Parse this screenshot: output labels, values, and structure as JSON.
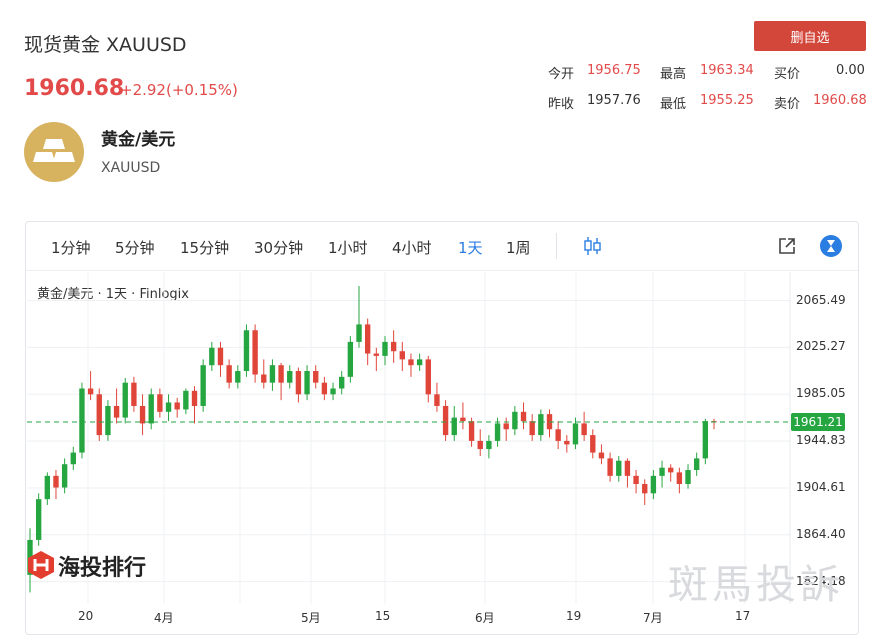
{
  "header": {
    "title": "现货黄金 XAUUSD",
    "price": "1960.68",
    "change": "+2.92(+0.15%)",
    "remove_button": "删自选"
  },
  "stats": [
    {
      "label": "今开",
      "value": "1956.75"
    },
    {
      "label": "最高",
      "value": "1963.34"
    },
    {
      "label": "买价",
      "value": "0.00"
    },
    {
      "label": "昨收",
      "value": "1957.76"
    },
    {
      "label": "最低",
      "value": "1955.25"
    },
    {
      "label": "卖价",
      "value": "1960.68"
    }
  ],
  "instrument": {
    "name": "黄金/美元",
    "code": "XAUUSD"
  },
  "toolbar": {
    "timeframes": [
      "1分钟",
      "5分钟",
      "15分钟",
      "30分钟",
      "1小时",
      "4小时",
      "1天",
      "1周"
    ],
    "active": "1天"
  },
  "chart_data": {
    "type": "candlestick",
    "legend": "黄金/美元 · 1天 · Finlogix",
    "y_ticks": [
      2065.49,
      2025.27,
      1985.05,
      1944.83,
      1904.61,
      1864.4,
      1824.18
    ],
    "ylim": [
      1805,
      2090
    ],
    "x_ticks": [
      "20",
      "4月",
      "5月",
      "15",
      "6月",
      "19",
      "7月",
      "17"
    ],
    "current_price": "1961.21",
    "candles": [
      [
        1830,
        1860,
        1815,
        1870
      ],
      [
        1860,
        1895,
        1855,
        1900
      ],
      [
        1895,
        1915,
        1890,
        1918
      ],
      [
        1915,
        1905,
        1895,
        1920
      ],
      [
        1905,
        1925,
        1900,
        1930
      ],
      [
        1925,
        1935,
        1920,
        1940
      ],
      [
        1935,
        1990,
        1930,
        1995
      ],
      [
        1990,
        1985,
        1980,
        2005
      ],
      [
        1985,
        1950,
        1945,
        1990
      ],
      [
        1950,
        1975,
        1945,
        1980
      ],
      [
        1975,
        1965,
        1960,
        1990
      ],
      [
        1965,
        1995,
        1960,
        1999
      ],
      [
        1995,
        1975,
        1970,
        2000
      ],
      [
        1975,
        1960,
        1950,
        1985
      ],
      [
        1960,
        1985,
        1955,
        1990
      ],
      [
        1985,
        1970,
        1965,
        1990
      ],
      [
        1970,
        1978,
        1962,
        1985
      ],
      [
        1978,
        1972,
        1965,
        1982
      ],
      [
        1972,
        1988,
        1968,
        1990
      ],
      [
        1988,
        1975,
        1960,
        1992
      ],
      [
        1975,
        2010,
        1970,
        2015
      ],
      [
        2010,
        2025,
        2005,
        2030
      ],
      [
        2025,
        2010,
        2000,
        2030
      ],
      [
        2010,
        1995,
        1990,
        2015
      ],
      [
        1995,
        2005,
        1990,
        2010
      ],
      [
        2005,
        2040,
        2000,
        2045
      ],
      [
        2040,
        2002,
        1995,
        2045
      ],
      [
        2002,
        1995,
        1990,
        2015
      ],
      [
        1995,
        2010,
        1988,
        2015
      ],
      [
        2010,
        1995,
        1980,
        2012
      ],
      [
        1995,
        2005,
        1990,
        2010
      ],
      [
        2005,
        1985,
        1978,
        2008
      ],
      [
        1985,
        2005,
        1980,
        2010
      ],
      [
        2005,
        1995,
        1990,
        2010
      ],
      [
        1995,
        1985,
        1980,
        2000
      ],
      [
        1985,
        1990,
        1980,
        1995
      ],
      [
        1990,
        2000,
        1985,
        2005
      ],
      [
        2000,
        2030,
        1995,
        2035
      ],
      [
        2030,
        2045,
        2025,
        2078
      ],
      [
        2045,
        2020,
        2010,
        2050
      ],
      [
        2020,
        2018,
        2005,
        2025
      ],
      [
        2018,
        2030,
        2010,
        2035
      ],
      [
        2030,
        2022,
        2012,
        2040
      ],
      [
        2022,
        2015,
        2005,
        2030
      ],
      [
        2015,
        2010,
        2000,
        2020
      ],
      [
        2010,
        2015,
        2005,
        2020
      ],
      [
        2015,
        1985,
        1978,
        2018
      ],
      [
        1985,
        1975,
        1970,
        1995
      ],
      [
        1975,
        1950,
        1945,
        1980
      ],
      [
        1950,
        1965,
        1945,
        1975
      ],
      [
        1965,
        1962,
        1955,
        1978
      ],
      [
        1962,
        1945,
        1940,
        1965
      ],
      [
        1945,
        1938,
        1932,
        1955
      ],
      [
        1938,
        1945,
        1930,
        1950
      ],
      [
        1945,
        1960,
        1940,
        1965
      ],
      [
        1960,
        1955,
        1945,
        1965
      ],
      [
        1955,
        1970,
        1950,
        1975
      ],
      [
        1970,
        1962,
        1955,
        1978
      ],
      [
        1962,
        1950,
        1945,
        1968
      ],
      [
        1950,
        1968,
        1945,
        1972
      ],
      [
        1968,
        1955,
        1948,
        1972
      ],
      [
        1955,
        1945,
        1938,
        1962
      ],
      [
        1945,
        1942,
        1935,
        1950
      ],
      [
        1942,
        1960,
        1938,
        1965
      ],
      [
        1960,
        1950,
        1945,
        1970
      ],
      [
        1950,
        1935,
        1930,
        1955
      ],
      [
        1935,
        1930,
        1925,
        1942
      ],
      [
        1930,
        1915,
        1910,
        1935
      ],
      [
        1915,
        1928,
        1910,
        1932
      ],
      [
        1928,
        1915,
        1905,
        1930
      ],
      [
        1915,
        1908,
        1900,
        1920
      ],
      [
        1908,
        1900,
        1890,
        1912
      ],
      [
        1900,
        1915,
        1895,
        1920
      ],
      [
        1915,
        1922,
        1905,
        1928
      ],
      [
        1922,
        1918,
        1910,
        1925
      ],
      [
        1918,
        1908,
        1900,
        1922
      ],
      [
        1908,
        1920,
        1904,
        1925
      ],
      [
        1920,
        1930,
        1915,
        1935
      ],
      [
        1930,
        1962,
        1925,
        1964
      ],
      [
        1962,
        1961,
        1955,
        1964
      ]
    ]
  }
}
